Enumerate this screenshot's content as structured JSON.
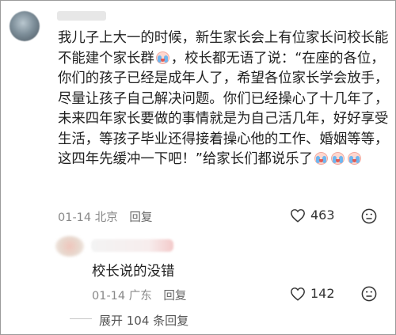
{
  "comment1": {
    "text_part1": "我儿子上大一的时候，新生家长会上有位家长问校长能不能建个家长群",
    "text_part2": "，校长都无语了说：“在座的各位，你们的孩子已经是成年人了，希望各位家长学会放手，尽量让孩子自己解决问题。你们已经操心了十几年了，未来四年家长要做的事情就是为自己活几年，好好享受生活，等孩子毕业还得接着操心他的工作、婚姻等等，这四年先缓冲一下吧！”给家长们都说乐了",
    "date": "01-14",
    "location": "北京",
    "reply_label": "回复",
    "likes": "463"
  },
  "comment2": {
    "text": "校长说的没错",
    "date": "01-14",
    "location": "广东",
    "reply_label": "回复",
    "likes": "142"
  },
  "expand_replies": "展开 104 条回复",
  "icons": [
    "heart-icon",
    "dislike-face-icon",
    "crying-laughing-emoji"
  ]
}
